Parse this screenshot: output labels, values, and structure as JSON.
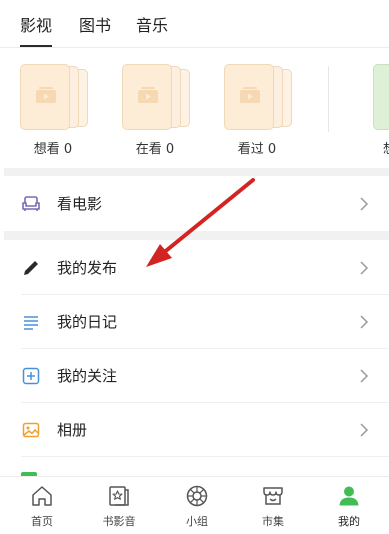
{
  "tabs": [
    {
      "label": "影视",
      "active": true
    },
    {
      "label": "图书",
      "active": false
    },
    {
      "label": "音乐",
      "active": false
    }
  ],
  "shelf": {
    "items": [
      {
        "label": "想看 0"
      },
      {
        "label": "在看 0"
      },
      {
        "label": "看过 0"
      }
    ],
    "partial_label": "想"
  },
  "menu": [
    {
      "label": "看电影",
      "icon": "sofa-icon"
    },
    {
      "label": "我的发布",
      "icon": "pen-icon"
    },
    {
      "label": "我的日记",
      "icon": "lines-icon"
    },
    {
      "label": "我的关注",
      "icon": "plus-square-icon"
    },
    {
      "label": "相册",
      "icon": "photo-icon"
    }
  ],
  "bottom_nav": [
    {
      "label": "首页",
      "icon": "home-icon",
      "active": false
    },
    {
      "label": "书影音",
      "icon": "book-star-icon",
      "active": false
    },
    {
      "label": "小组",
      "icon": "group-icon",
      "active": false
    },
    {
      "label": "市集",
      "icon": "market-icon",
      "active": false
    },
    {
      "label": "我的",
      "icon": "user-icon",
      "active": true
    }
  ],
  "colors": {
    "accent_green": "#42bd56",
    "arrow_red": "#d32424",
    "card_peach": "#fdecd6"
  }
}
